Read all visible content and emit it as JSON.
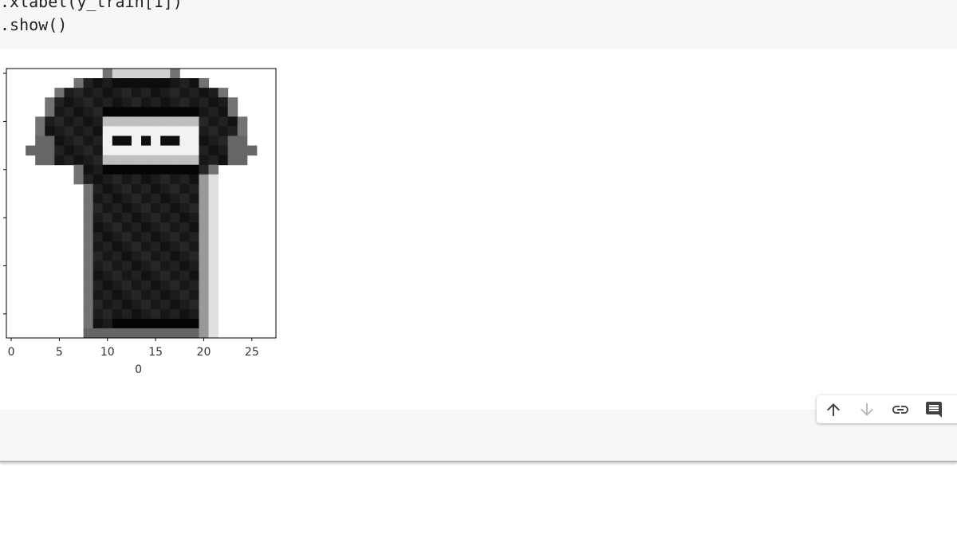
{
  "code_cell": {
    "line1": ".xlabel(y_train[1])",
    "line2": ".show()"
  },
  "chart_data": {
    "type": "heatmap",
    "colormap": "binary",
    "xlabel": "0",
    "xticks": [
      "0",
      "5",
      "10",
      "15",
      "20",
      "25"
    ],
    "yticks_labeled": false,
    "xlim": [
      -0.5,
      27.5
    ],
    "ylim": [
      27.5,
      -0.5
    ],
    "description": "28x28 grayscale image of a T-shirt (Fashion-MNIST sample), displayed with binary colormap",
    "grid": false
  },
  "toolbar": {
    "icons": [
      "arrow-up-icon",
      "arrow-down-icon",
      "link-icon",
      "comment-icon"
    ]
  },
  "colors": {
    "cell_background": "#f7f7f7",
    "icon_active": "#424242",
    "icon_disabled": "#bdbdbd"
  }
}
